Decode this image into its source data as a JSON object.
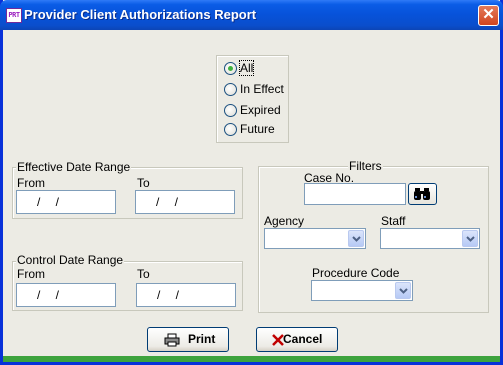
{
  "window": {
    "title": "Provider Client Authorizations Report",
    "icon_text": "PRT",
    "close_glyph": "✕"
  },
  "status_options": {
    "selected": "All",
    "items": [
      {
        "label": "All",
        "checked": true
      },
      {
        "label": "In Effect",
        "checked": false
      },
      {
        "label": "Expired",
        "checked": false
      },
      {
        "label": "Future",
        "checked": false
      }
    ]
  },
  "effective_date_range": {
    "legend": "Effective Date Range",
    "from_label": "From",
    "to_label": "To",
    "from_value": "/  /",
    "to_value": "/  /"
  },
  "control_date_range": {
    "legend": "Control Date Range",
    "from_label": "From",
    "to_label": "To",
    "from_value": "/  /",
    "to_value": "/  /"
  },
  "filters": {
    "legend": "Filters",
    "case_no_label": "Case No.",
    "case_no_value": "",
    "find_icon": "binoculars-icon",
    "agency_label": "Agency",
    "agency_value": "",
    "staff_label": "Staff",
    "staff_value": "",
    "procedure_code_label": "Procedure Code",
    "procedure_code_value": ""
  },
  "buttons": {
    "print_label": "Print",
    "print_icon": "printer-icon",
    "cancel_label": "Cancel",
    "cancel_icon": "cancel-x-icon"
  },
  "colors": {
    "title_bar": "#0752d9",
    "dialog_bg": "#ecebe4",
    "radio_dot": "#3fb23f",
    "bottom_bar": "#3da33d"
  }
}
